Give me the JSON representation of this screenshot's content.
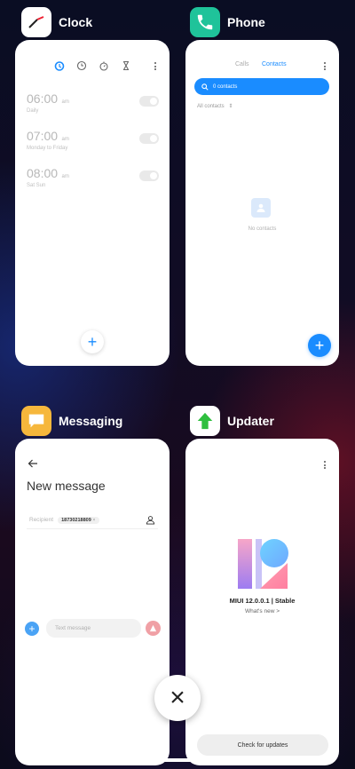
{
  "clock": {
    "app_name": "Clock",
    "alarms": [
      {
        "time": "06:00",
        "suffix": "am",
        "label": "Daily"
      },
      {
        "time": "07:00",
        "suffix": "am",
        "label": "Monday to Friday"
      },
      {
        "time": "08:00",
        "suffix": "am",
        "label": "Sat Sun"
      }
    ],
    "add_icon": "+"
  },
  "phone": {
    "app_name": "Phone",
    "tabs": [
      "Calls",
      "Contacts"
    ],
    "active_tab": "Contacts",
    "contacts_bar": "0 contacts",
    "filter": "All contacts",
    "empty_text": "No contacts",
    "accent": "#1a8cff"
  },
  "messaging": {
    "app_name": "Messaging",
    "title": "New message",
    "recipient_label": "Recipient",
    "recipient_chip": "18730218809",
    "input_placeholder": "Text message"
  },
  "updater": {
    "app_name": "Updater",
    "version": "MIUI 12.0.0.1 | Stable",
    "whats_new": "What's new >",
    "button": "Check for updates"
  },
  "close_icon": "×"
}
